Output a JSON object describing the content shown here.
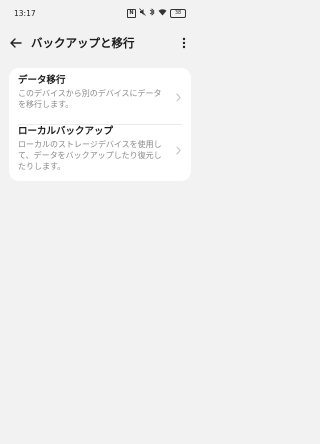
{
  "status_bar": {
    "time": "13:17",
    "battery": "38",
    "icons": [
      "nfc-icon",
      "mute-icon",
      "bluetooth-icon",
      "wifi-icon",
      "battery-icon"
    ]
  },
  "app_bar": {
    "title": "バックアップと移行",
    "back_icon": "arrow-left-icon",
    "more_icon": "more-vertical-icon"
  },
  "items": [
    {
      "title": "データ移行",
      "description": "このデバイスから別のデバイスにデータを移行します。"
    },
    {
      "title": "ローカルバックアップ",
      "description": "ローカルのストレージデバイスを使用して、データをバックアップしたり復元したりします。"
    }
  ],
  "colors": {
    "background": "#f2f2f3",
    "card": "#ffffff",
    "secondary_text": "#8a8a8a"
  }
}
